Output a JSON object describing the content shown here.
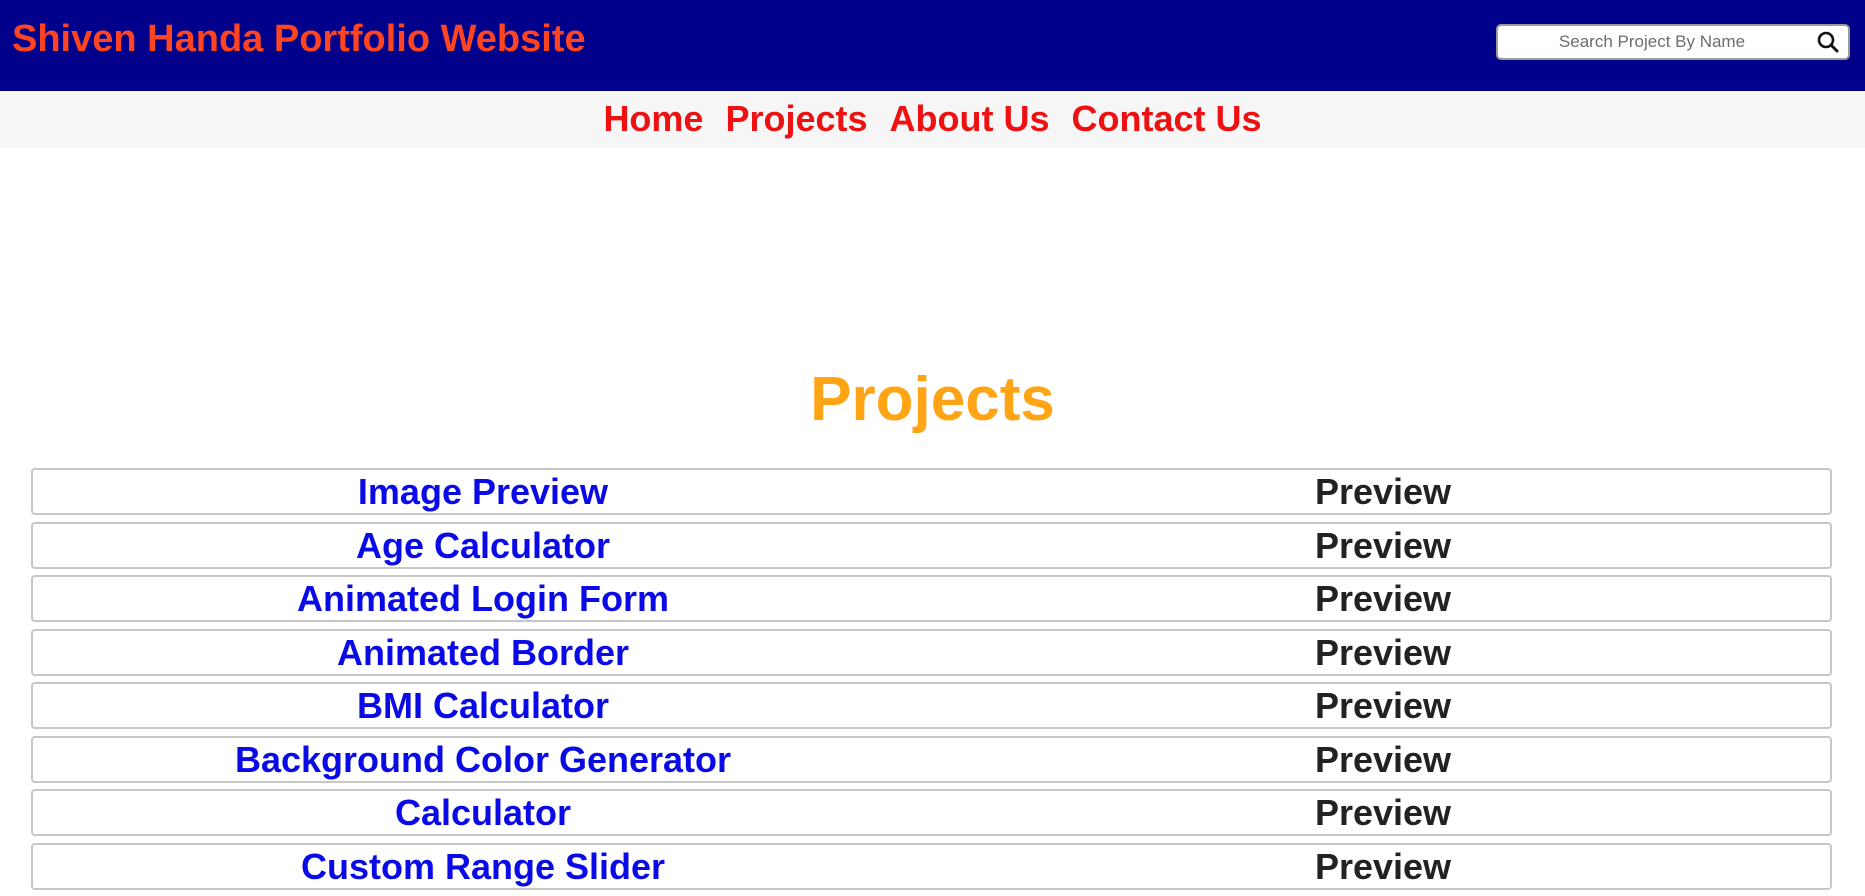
{
  "header": {
    "title": "Shiven Handa Portfolio Website",
    "search": {
      "placeholder": "Search Project By Name",
      "value": "",
      "icon": "search-icon"
    }
  },
  "nav": {
    "items": [
      {
        "label": "Home"
      },
      {
        "label": "Projects"
      },
      {
        "label": "About Us"
      },
      {
        "label": "Contact Us"
      }
    ]
  },
  "main": {
    "heading": "Projects",
    "projects": [
      {
        "name": "Image Preview",
        "preview": "Preview"
      },
      {
        "name": "Age Calculator",
        "preview": "Preview"
      },
      {
        "name": "Animated Login Form",
        "preview": "Preview"
      },
      {
        "name": "Animated Border",
        "preview": "Preview"
      },
      {
        "name": "BMI Calculator",
        "preview": "Preview"
      },
      {
        "name": "Background Color Generator",
        "preview": "Preview"
      },
      {
        "name": "Calculator",
        "preview": "Preview"
      },
      {
        "name": "Custom Range Slider",
        "preview": "Preview"
      }
    ]
  },
  "colors": {
    "header_bg": "#00008b",
    "title": "#ff4422",
    "nav_link": "#ee1111",
    "heading": "#ffa515",
    "project_link": "#0a0ae6",
    "preview_text": "#222222"
  }
}
